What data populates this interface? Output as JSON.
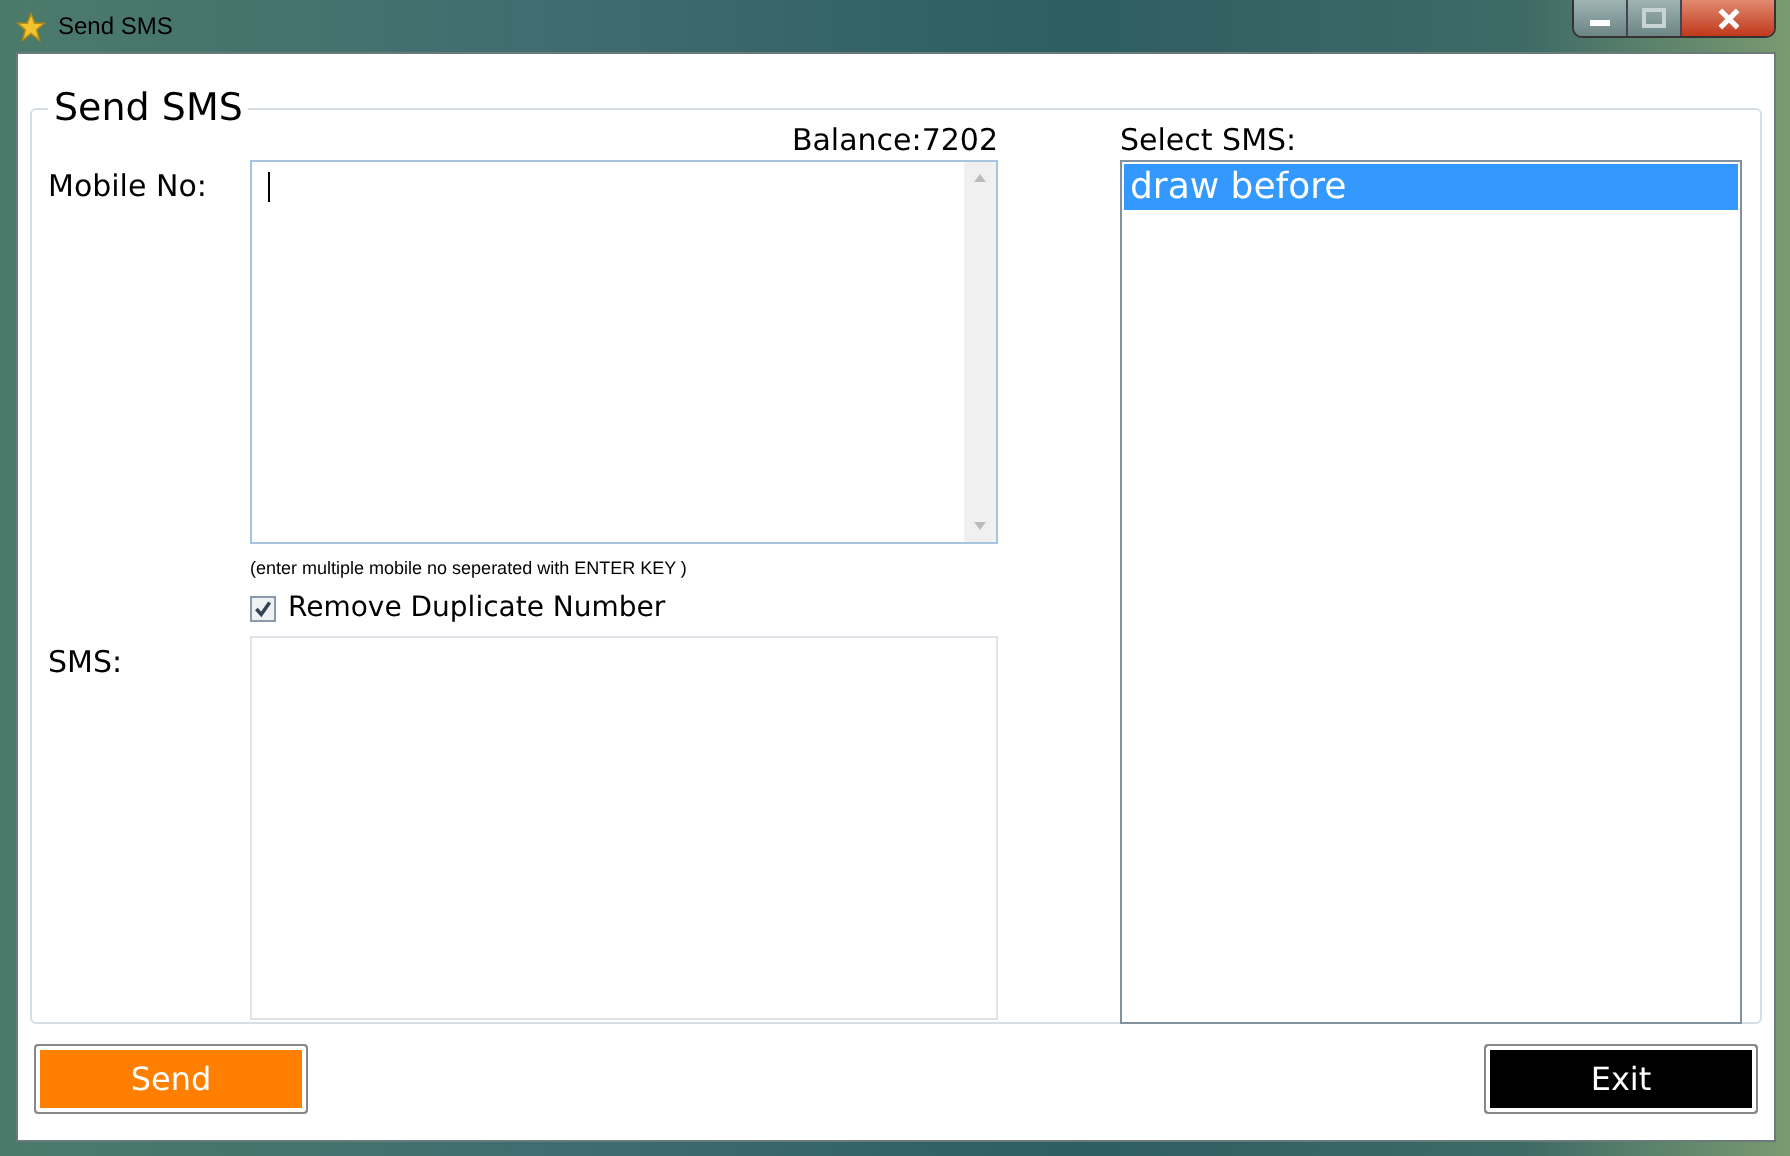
{
  "window": {
    "title": "Send SMS"
  },
  "group": {
    "title": "Send SMS"
  },
  "balance": "Balance:7202",
  "mobile": {
    "label": "Mobile No:",
    "hint": "(enter multiple mobile no seperated with ENTER KEY )"
  },
  "remove_duplicates": {
    "label": "Remove Duplicate Number",
    "checked": true
  },
  "sms": {
    "label": "SMS:"
  },
  "select_sms": {
    "label": "Select SMS:",
    "items": [
      {
        "text": "draw before",
        "selected": true
      }
    ]
  },
  "buttons": [
    {
      "kind": "send",
      "label": "Send"
    },
    {
      "kind": "exit",
      "label": "Exit"
    }
  ]
}
